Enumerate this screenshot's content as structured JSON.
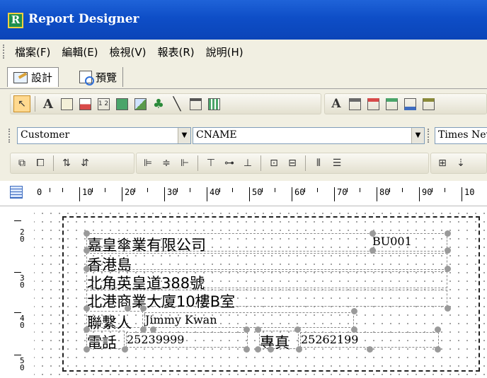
{
  "window": {
    "title": "Report Designer",
    "icon": "report-designer-app-icon"
  },
  "menu": [
    "檔案(F)",
    "編輯(E)",
    "檢視(V)",
    "報表(R)",
    "說明(H)"
  ],
  "tabs": [
    {
      "label": "設計",
      "icon": "design-icon",
      "active": true
    },
    {
      "label": "預覽",
      "icon": "preview-icon",
      "active": false
    }
  ],
  "combos": {
    "datasource": "Customer",
    "field": "CNAME",
    "font": "Times New Roman"
  },
  "ruler": {
    "labels": [
      "0",
      "10",
      "20",
      "30",
      "40",
      "50",
      "60",
      "70",
      "80",
      "90",
      "10"
    ]
  },
  "vruler": {
    "labels": [
      "2\n0",
      "3\n0",
      "4\n0",
      "5\n0"
    ]
  },
  "report": {
    "company": "嘉皇傘業有限公司",
    "code": "BU001",
    "addr1": "香港島",
    "addr2": "北角英皇道388號",
    "addr3": "北港商業大廈10樓B室",
    "contact_label": "聯繫人",
    "contact_value": "Jimmy Kwan",
    "phone_label": "電話",
    "phone_value": "25239999",
    "fax_label": "專真",
    "fax_value": "25262199"
  },
  "colors": {
    "title_bar": "#0e4ec7",
    "chrome": "#f1efe2",
    "selection": "#ffd98f"
  }
}
